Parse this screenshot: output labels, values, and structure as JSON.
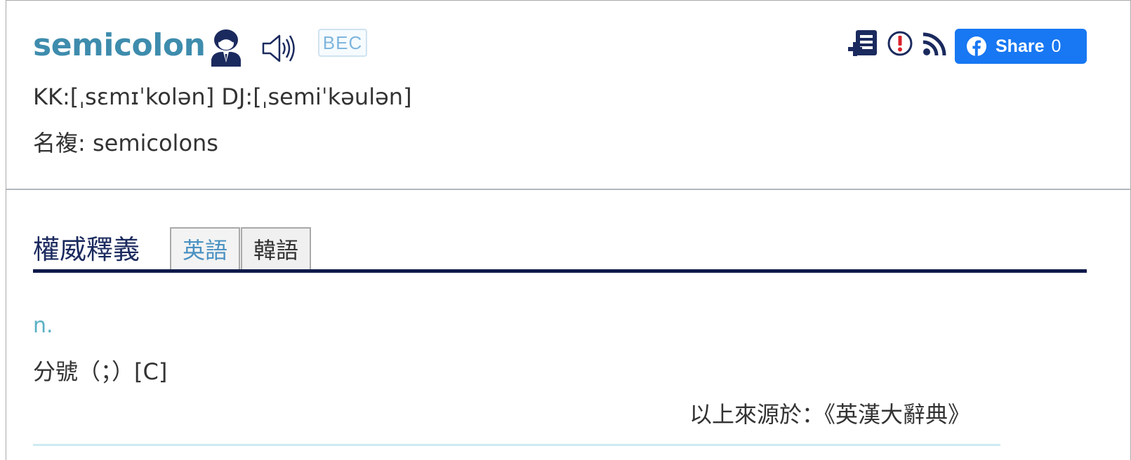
{
  "entry": {
    "word": "semicolon",
    "badge": "BEC",
    "pronunciation": "KK:[ˌsɛmɪˈkolən] DJ:[ˌsemiˈkəulən]",
    "plural": "名複: semicolons"
  },
  "toolbar": {
    "share_label": "Share",
    "share_count": "0"
  },
  "definitions": {
    "title": "權威釋義",
    "tabs": [
      {
        "label": "英語",
        "active": true
      },
      {
        "label": "韓語",
        "active": false
      }
    ],
    "part_of_speech": "n.",
    "meaning": "分號（；）[C]",
    "source": "以上來源於：《英漢大辭典》"
  },
  "colors": {
    "word": "#3e8cad",
    "facebook": "#1877f2",
    "title": "#1b2a5e",
    "rule": "#0e1a4a",
    "pos": "#5ab0c4"
  },
  "icons": [
    "person-icon",
    "speaker-icon",
    "add-to-list-icon",
    "report-icon",
    "rss-icon",
    "facebook-logo-icon"
  ]
}
